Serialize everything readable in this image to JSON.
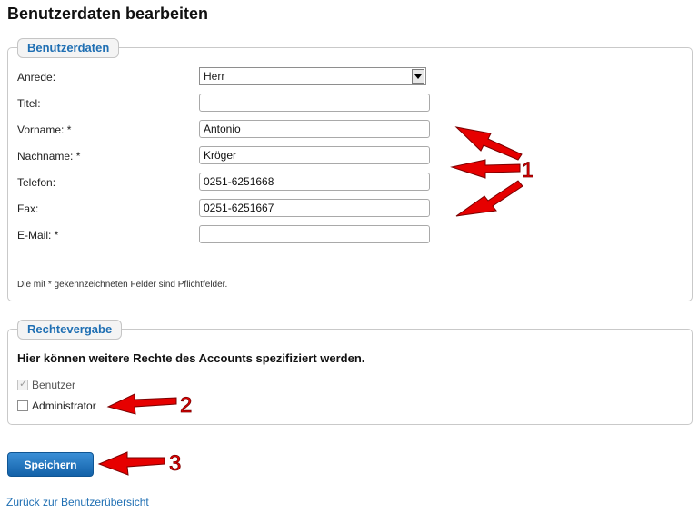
{
  "page": {
    "title": "Benutzerdaten bearbeiten"
  },
  "user_data": {
    "legend": "Benutzerdaten",
    "fields": {
      "salutation": {
        "label": "Anrede:",
        "value": "Herr"
      },
      "title": {
        "label": "Titel:",
        "value": ""
      },
      "first_name": {
        "label": "Vorname: *",
        "value": "Antonio"
      },
      "last_name": {
        "label": "Nachname: *",
        "value": "Kröger"
      },
      "phone": {
        "label": "Telefon:",
        "value": "0251-6251668"
      },
      "fax": {
        "label": "Fax:",
        "value": "0251-6251667"
      },
      "email": {
        "label": "E-Mail: *",
        "value": ""
      }
    },
    "required_note": "Die mit * gekennzeichneten Felder sind Pflichtfelder."
  },
  "permissions": {
    "legend": "Rechtevergabe",
    "heading": "Hier können weitere Rechte des Accounts spezifiziert werden.",
    "options": [
      {
        "label": "Benutzer",
        "checked": true,
        "disabled": true
      },
      {
        "label": "Administrator",
        "checked": false,
        "disabled": false
      }
    ]
  },
  "actions": {
    "save_label": "Speichern",
    "back_link": "Zurück zur Benutzerübersicht"
  },
  "annotations": {
    "marker_1": "1",
    "marker_2": "2",
    "marker_3": "3",
    "arrow_color": "#e60000"
  }
}
